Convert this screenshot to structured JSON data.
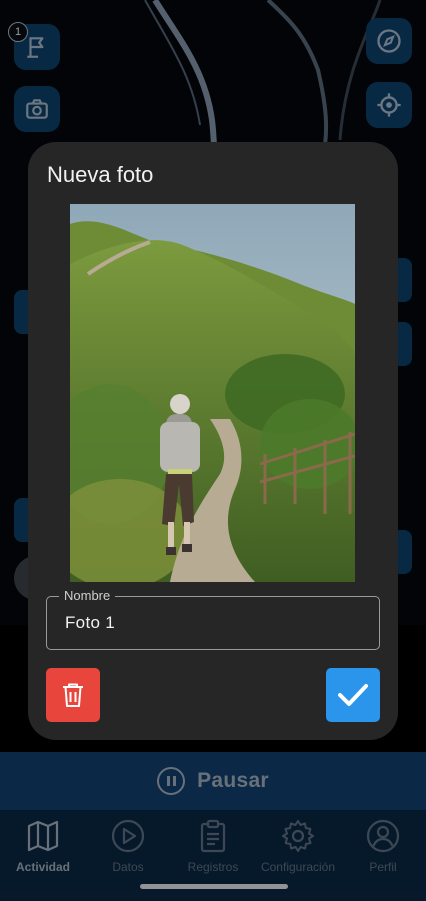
{
  "map": {
    "badge_count": "1",
    "icons": [
      "flag-icon",
      "camera-icon",
      "compass-icon",
      "my-location-icon"
    ]
  },
  "dialog": {
    "title": "Nueva foto",
    "photo_icon": "photo-of-hiker-on-path",
    "name_field": {
      "label": "Nombre",
      "value": "Foto 1"
    },
    "delete_icon": "trash-icon",
    "confirm_icon": "check-icon",
    "colors": {
      "delete": "#e8453c",
      "confirm": "#2a95ea"
    }
  },
  "pause_bar": {
    "label": "Pausar",
    "icon": "pause-circle-icon"
  },
  "bottom_nav": {
    "items": [
      {
        "label": "Actividad",
        "icon": "map-icon",
        "active": true
      },
      {
        "label": "Datos",
        "icon": "play-circle-icon",
        "active": false
      },
      {
        "label": "Registros",
        "icon": "clipboard-icon",
        "active": false
      },
      {
        "label": "Configuración",
        "icon": "gear-icon",
        "active": false
      },
      {
        "label": "Perfil",
        "icon": "user-icon",
        "active": false
      }
    ]
  }
}
